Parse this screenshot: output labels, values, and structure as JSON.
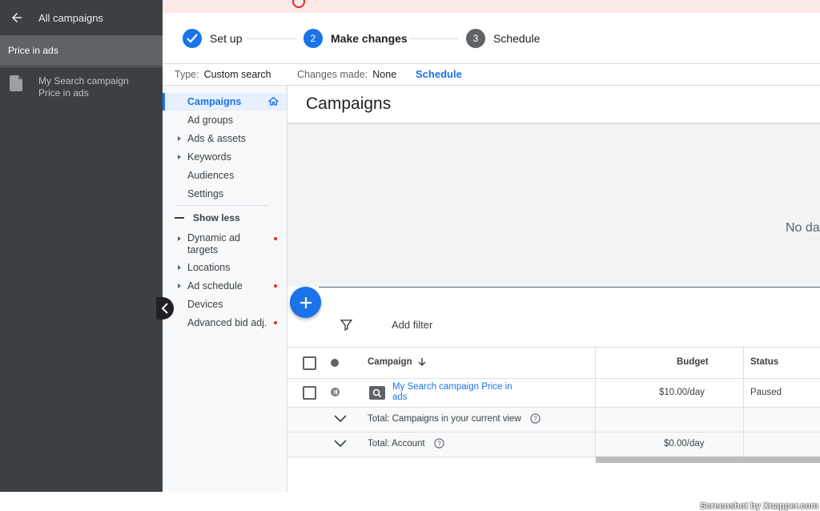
{
  "sidebar": {
    "back_label": "All campaigns",
    "selected": "Price in ads",
    "campaign_line1": "My Search campaign",
    "campaign_line2": "Price in ads"
  },
  "stepper": {
    "steps": [
      {
        "label": "Set up",
        "state": "done"
      },
      {
        "label": "Make changes",
        "number": "2",
        "state": "active"
      },
      {
        "label": "Schedule",
        "number": "3",
        "state": "todo"
      }
    ]
  },
  "infobar": {
    "type_label": "Type:",
    "type_value": "Custom search",
    "changes_label": "Changes made:",
    "changes_value": "None",
    "schedule_link": "Schedule"
  },
  "nav": {
    "items": [
      {
        "label": "Campaigns",
        "active": true
      },
      {
        "label": "Ad groups"
      },
      {
        "label": "Ads & assets",
        "expandable": true
      },
      {
        "label": "Keywords",
        "expandable": true
      },
      {
        "label": "Audiences"
      },
      {
        "label": "Settings"
      }
    ],
    "show_less": "Show less",
    "more_items": [
      {
        "label_line1": "Dynamic ad",
        "label_line2": "targets",
        "expandable": true,
        "alert": true
      },
      {
        "label": "Locations",
        "expandable": true
      },
      {
        "label": "Ad schedule",
        "expandable": true,
        "alert": true
      },
      {
        "label": "Devices"
      },
      {
        "label": "Advanced bid adj.",
        "alert": true
      }
    ]
  },
  "main": {
    "title": "Campaigns",
    "no_data_text": "No da",
    "add_filter": "Add filter"
  },
  "table": {
    "headers": {
      "campaign": "Campaign",
      "budget": "Budget",
      "status": "Status"
    },
    "row": {
      "campaign_line1": "My Search campaign Price in",
      "campaign_line2": "ads",
      "budget": "$10.00/day",
      "status": "Paused"
    },
    "total_view": "Total: Campaigns in your current view",
    "total_account": "Total: Account",
    "total_account_budget": "$0.00/day"
  },
  "colors": {
    "accent": "#1a73e8",
    "sidebar_bg": "#3c4043",
    "alert": "#d93025"
  },
  "watermark": "Screenshot by Xnapper.com"
}
